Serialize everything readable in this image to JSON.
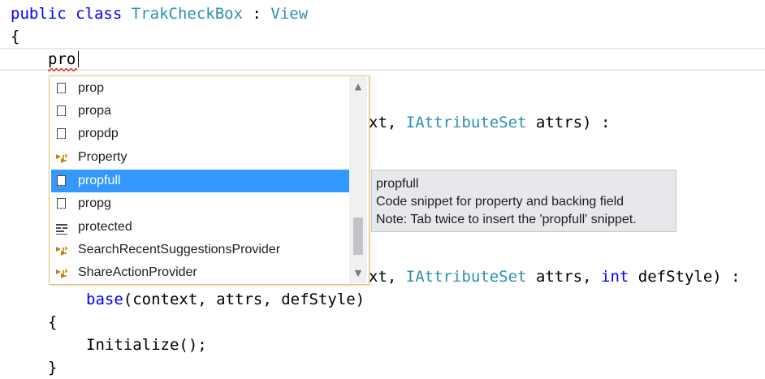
{
  "editor": {
    "line1": {
      "kw1": "public",
      "kw2": "class",
      "classname": "TrakCheckBox",
      "colon": ":",
      "base": "View"
    },
    "line2": "{",
    "typed": "pro",
    "line_ctor1_tail": {
      "frag": "xt, ",
      "type": "IAttributeSet",
      "rest": " attrs) :"
    },
    "line_ctor2_tail": {
      "frag": "xt, ",
      "type": "IAttributeSet",
      "mid": " attrs, ",
      "kw": "int",
      "rest": " defStyle) :"
    },
    "line_base": {
      "kw": "base",
      "rest": "(context, attrs, defStyle)"
    },
    "line_open": "{",
    "line_init": "Initialize();",
    "line_close": "}"
  },
  "completion": {
    "items": [
      {
        "label": "prop",
        "icon": "snippet-icon"
      },
      {
        "label": "propa",
        "icon": "snippet-icon"
      },
      {
        "label": "propdp",
        "icon": "snippet-icon"
      },
      {
        "label": "Property",
        "icon": "class-icon"
      },
      {
        "label": "propfull",
        "icon": "snippet-icon",
        "selected": true
      },
      {
        "label": "propg",
        "icon": "snippet-icon"
      },
      {
        "label": "protected",
        "icon": "keyword-icon"
      },
      {
        "label": "SearchRecentSuggestionsProvider",
        "icon": "class-icon"
      },
      {
        "label": "ShareActionProvider",
        "icon": "class-icon"
      }
    ],
    "scroll_up": "▲",
    "scroll_down": "▼"
  },
  "tooltip": {
    "title": "propfull",
    "description": "Code snippet for property and backing field",
    "note": "Note: Tab twice to insert the 'propfull' snippet."
  },
  "colors": {
    "keyword": "#0000ff",
    "type": "#2b91af",
    "selection": "#3399ff",
    "popup_border": "#e5c365",
    "tooltip_bg": "#e7e8ec"
  }
}
